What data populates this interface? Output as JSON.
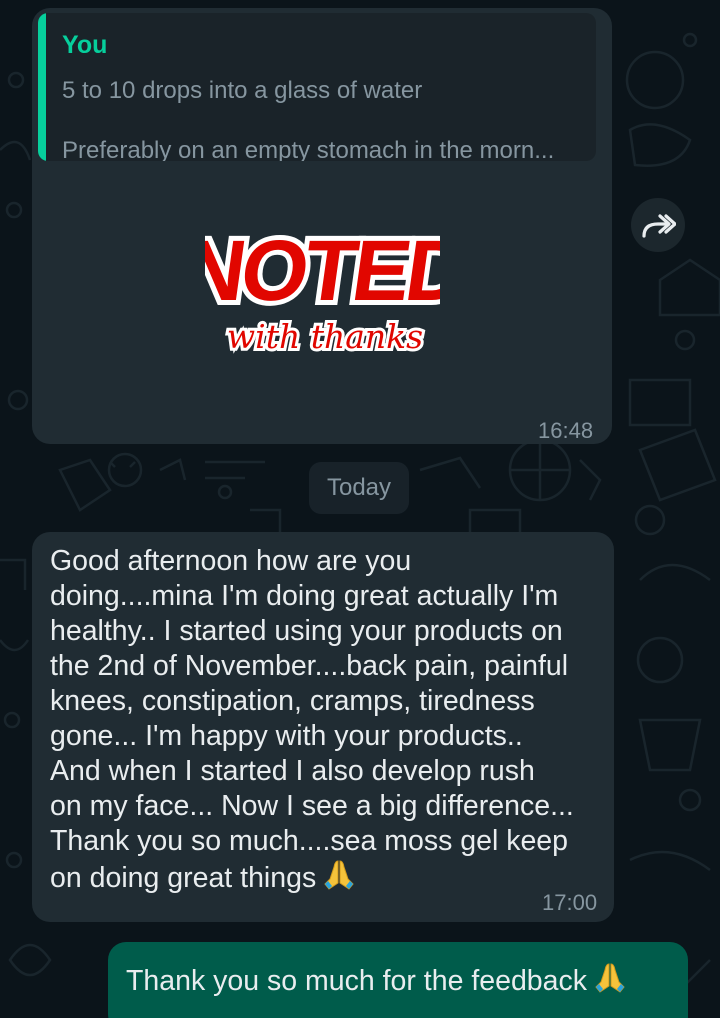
{
  "colors": {
    "background": "#0b141a",
    "incoming_bubble": "#202c33",
    "outgoing_bubble": "#005c4b",
    "quote_accent": "#06cf9c",
    "meta_text": "#8696a0",
    "sticker_red": "#e10600"
  },
  "sticker_message": {
    "quote": {
      "author": "You",
      "line1": "5 to 10 drops into a glass of water",
      "line2": "Preferably on an empty stomach in the morn..."
    },
    "sticker": {
      "icon": "noted-with-thanks-sticker",
      "title": "NOTED",
      "subtitle": "with thanks"
    },
    "time": "16:48"
  },
  "forward_icon": "forward-arrow-icon",
  "date_chip": "Today",
  "incoming_message": {
    "text": "Good afternoon how are you\ndoing....mina I'm doing great actually I'm\nhealthy.. I started using your products on\nthe 2nd of November....back pain, painful\nknees, constipation, cramps, tiredness\ngone... I'm happy with your products..\nAnd when I started I also develop rush\non my face... Now I see a big difference...\nThank you so much....sea moss gel keep\non doing great things",
    "emoji": "folded-hands-icon",
    "time": "17:00"
  },
  "outgoing_message": {
    "text": "Thank you so much for the feedback",
    "emoji": "folded-hands-icon"
  }
}
